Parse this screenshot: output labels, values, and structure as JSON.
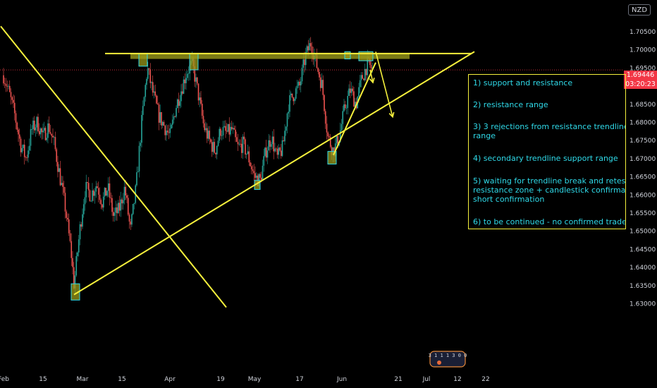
{
  "currency_label": "NZD",
  "last_price_label": "1.69446",
  "countdown_label": "03:20:23",
  "notes": [
    "1) support and resistance",
    "2) resistance range",
    "3) 3 rejections from resistance trendline",
    "range",
    "4) secondary trendline support range",
    "5) waiting for trendline break and retest",
    "resistance zone + candlestick confirmation",
    "short confirmation",
    "6) to be continued - no confirmed trade"
  ],
  "watermark_digits": "3 1 1 1 3 0 0",
  "colors": {
    "background": "#000000",
    "bull_candle": "#26a69a",
    "bear_candle": "#ef5350",
    "trendline": "#f5f03c",
    "zone_fill": "#9a9a1a",
    "zone_border": "#2fd9e8",
    "note_text": "#2fd9e8",
    "price_tag": "#f23645"
  },
  "chart_data": {
    "type": "candlestick",
    "y_ticks": [
      1.705,
      1.7,
      1.695,
      1.69,
      1.685,
      1.68,
      1.675,
      1.67,
      1.665,
      1.66,
      1.655,
      1.65,
      1.645,
      1.64,
      1.635,
      1.63
    ],
    "y_range": [
      1.628,
      1.71
    ],
    "x_ticks": [
      "Feb",
      "15",
      "Mar",
      "15",
      "Apr",
      "19",
      "May",
      "17",
      "Jun",
      "21",
      "Jul",
      "12",
      "22"
    ],
    "date_range": [
      "2021-02-01",
      "2021-07-26"
    ],
    "last_price": 1.69446,
    "key_levels": {
      "resistance": 1.699,
      "swing_low": 1.634,
      "recent_low": 1.664,
      "prior_high": 1.7055
    },
    "resistance_line": {
      "from": {
        "date": "2021-03-09",
        "price": 1.699
      },
      "to": {
        "date": "2021-07-17",
        "price": 1.699
      }
    },
    "support_trendline": {
      "from": {
        "date": "2021-02-26",
        "price": 1.6325
      },
      "to": {
        "date": "2021-07-18",
        "price": 1.6995
      }
    },
    "falling_trendline": {
      "from": {
        "date": "2021-01-31",
        "price": 1.7065
      },
      "to": {
        "date": "2021-04-21",
        "price": 1.629
      }
    },
    "secondary_trendline": {
      "from": {
        "date": "2021-05-29",
        "price": 1.671
      },
      "to": {
        "date": "2021-06-13",
        "price": 1.6965
      }
    },
    "projection_arrows": [
      {
        "from": {
          "date": "2021-06-13",
          "price": 1.6995
        },
        "to": {
          "date": "2021-06-19",
          "price": 1.6815
        }
      },
      {
        "from": {
          "date": "2021-06-11",
          "price": 1.6945
        },
        "to": {
          "date": "2021-06-12",
          "price": 1.691
        }
      }
    ],
    "highlight_boxes": [
      {
        "date_from": "2021-02-25",
        "date_to": "2021-02-28",
        "price_low": 1.631,
        "price_high": 1.6355
      },
      {
        "date_from": "2021-03-21",
        "date_to": "2021-03-24",
        "price_low": 1.6955,
        "price_high": 1.699
      },
      {
        "date_from": "2021-04-08",
        "date_to": "2021-04-11",
        "price_low": 1.6945,
        "price_high": 1.699
      },
      {
        "date_from": "2021-05-01",
        "date_to": "2021-05-03",
        "price_low": 1.6615,
        "price_high": 1.664
      },
      {
        "date_from": "2021-05-27",
        "date_to": "2021-05-30",
        "price_low": 1.6685,
        "price_high": 1.672
      },
      {
        "date_from": "2021-06-02",
        "date_to": "2021-06-04",
        "price_low": 1.6975,
        "price_high": 1.6995
      },
      {
        "date_from": "2021-06-07",
        "date_to": "2021-06-12",
        "price_low": 1.697,
        "price_high": 1.6995
      }
    ],
    "resistance_zone": {
      "date_from": "2021-03-18",
      "date_to": "2021-06-25",
      "price_low": 1.6975,
      "price_high": 1.699
    },
    "price_path": [
      [
        "2021-02-01",
        1.693
      ],
      [
        "2021-02-03",
        1.688
      ],
      [
        "2021-02-05",
        1.682
      ],
      [
        "2021-02-07",
        1.674
      ],
      [
        "2021-02-09",
        1.67
      ],
      [
        "2021-02-11",
        1.678
      ],
      [
        "2021-02-13",
        1.68
      ],
      [
        "2021-02-15",
        1.676
      ],
      [
        "2021-02-17",
        1.679
      ],
      [
        "2021-02-19",
        1.674
      ],
      [
        "2021-02-21",
        1.665
      ],
      [
        "2021-02-23",
        1.656
      ],
      [
        "2021-02-25",
        1.644
      ],
      [
        "2021-02-26",
        1.635
      ],
      [
        "2021-02-28",
        1.65
      ],
      [
        "2021-03-02",
        1.662
      ],
      [
        "2021-03-04",
        1.66
      ],
      [
        "2021-03-06",
        1.663
      ],
      [
        "2021-03-08",
        1.658
      ],
      [
        "2021-03-10",
        1.662
      ],
      [
        "2021-03-12",
        1.654
      ],
      [
        "2021-03-14",
        1.656
      ],
      [
        "2021-03-16",
        1.662
      ],
      [
        "2021-03-18",
        1.65
      ],
      [
        "2021-03-20",
        1.662
      ],
      [
        "2021-03-22",
        1.68
      ],
      [
        "2021-03-24",
        1.695
      ],
      [
        "2021-03-26",
        1.688
      ],
      [
        "2021-03-28",
        1.682
      ],
      [
        "2021-03-30",
        1.679
      ],
      [
        "2021-04-01",
        1.676
      ],
      [
        "2021-04-03",
        1.684
      ],
      [
        "2021-04-05",
        1.689
      ],
      [
        "2021-04-07",
        1.694
      ],
      [
        "2021-04-09",
        1.696
      ],
      [
        "2021-04-11",
        1.688
      ],
      [
        "2021-04-13",
        1.679
      ],
      [
        "2021-04-15",
        1.675
      ],
      [
        "2021-04-17",
        1.672
      ],
      [
        "2021-04-19",
        1.678
      ],
      [
        "2021-04-21",
        1.677
      ],
      [
        "2021-04-23",
        1.678
      ],
      [
        "2021-04-25",
        1.673
      ],
      [
        "2021-04-27",
        1.674
      ],
      [
        "2021-04-29",
        1.67
      ],
      [
        "2021-05-01",
        1.665
      ],
      [
        "2021-05-03",
        1.664
      ],
      [
        "2021-05-05",
        1.672
      ],
      [
        "2021-05-07",
        1.676
      ],
      [
        "2021-05-09",
        1.67
      ],
      [
        "2021-05-11",
        1.673
      ],
      [
        "2021-05-13",
        1.685
      ],
      [
        "2021-05-15",
        1.688
      ],
      [
        "2021-05-17",
        1.69
      ],
      [
        "2021-05-19",
        1.698
      ],
      [
        "2021-05-21",
        1.702
      ],
      [
        "2021-05-23",
        1.696
      ],
      [
        "2021-05-25",
        1.69
      ],
      [
        "2021-05-27",
        1.676
      ],
      [
        "2021-05-29",
        1.672
      ],
      [
        "2021-05-31",
        1.676
      ],
      [
        "2021-06-02",
        1.684
      ],
      [
        "2021-06-04",
        1.689
      ],
      [
        "2021-06-06",
        1.685
      ],
      [
        "2021-06-08",
        1.692
      ],
      [
        "2021-06-10",
        1.696
      ],
      [
        "2021-06-12",
        1.6945
      ]
    ]
  }
}
